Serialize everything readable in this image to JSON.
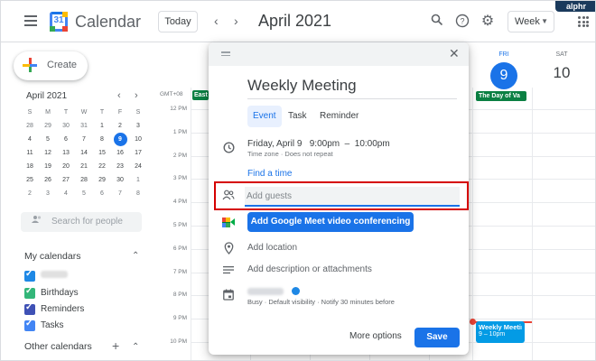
{
  "app": {
    "title": "Calendar",
    "logo_day": "31"
  },
  "watermark": "alphr",
  "toolbar": {
    "today_label": "Today",
    "prev_arrow": "‹",
    "next_arrow": "›",
    "month_title": "April 2021",
    "search_glyph": "⌕",
    "help_glyph": "?",
    "settings_glyph": "⚙",
    "view_select": "Week",
    "view_caret": "▼"
  },
  "sidebar": {
    "create_label": "Create",
    "mini_calendar": {
      "title": "April 2021",
      "prev": "‹",
      "next": "›",
      "weekday_headers": [
        "S",
        "M",
        "T",
        "W",
        "T",
        "F",
        "S"
      ],
      "weeks": [
        [
          "28",
          "29",
          "30",
          "31",
          "1",
          "2",
          "3"
        ],
        [
          "4",
          "5",
          "6",
          "7",
          "8",
          "9",
          "10"
        ],
        [
          "11",
          "12",
          "13",
          "14",
          "15",
          "16",
          "17"
        ],
        [
          "18",
          "19",
          "20",
          "21",
          "22",
          "23",
          "24"
        ],
        [
          "25",
          "26",
          "27",
          "28",
          "29",
          "30",
          "1"
        ],
        [
          "2",
          "3",
          "4",
          "5",
          "6",
          "7",
          "8"
        ]
      ],
      "selected_day": "9"
    },
    "search_people_placeholder": "Search for people",
    "my_calendars_title": "My calendars",
    "my_calendars_caret": "⌃",
    "my_calendars": [
      {
        "label": "",
        "color": "#1e88e5",
        "redacted": true
      },
      {
        "label": "Birthdays",
        "color": "#33b679"
      },
      {
        "label": "Reminders",
        "color": "#3f51b5"
      },
      {
        "label": "Tasks",
        "color": "#4285f4"
      }
    ],
    "other_calendars_title": "Other calendars",
    "other_calendars_add": "+",
    "other_calendars_caret": "⌃"
  },
  "week_grid": {
    "timezone": "GMT+08",
    "hours": [
      "12 PM",
      "1 PM",
      "2 PM",
      "3 PM",
      "4 PM",
      "5 PM",
      "6 PM",
      "7 PM",
      "8 PM",
      "9 PM",
      "10 PM"
    ],
    "allday_left_event": "East",
    "friday": {
      "name": "FRI",
      "num": "9"
    },
    "saturday": {
      "name": "SAT",
      "num": "10"
    },
    "allday_friday_event": "The Day of Va",
    "event": {
      "title": "Weekly Meetin",
      "time": "9 – 10pm",
      "color": "#039be5"
    }
  },
  "dialog": {
    "title": "Weekly Meeting",
    "tabs": [
      "Event",
      "Task",
      "Reminder"
    ],
    "active_tab": "Event",
    "datetime": "Friday, April 9   9:00pm  –  10:00pm",
    "datetime_sub": "Time zone · Does not repeat",
    "find_time": "Find a time",
    "guests_placeholder": "Add guests",
    "meet_button": "Add Google Meet video conferencing",
    "location": "Add location",
    "description": "Add description or attachments",
    "owner_sub": "Busy · Default visibility · Notify 30 minutes before",
    "more_options": "More options",
    "save_label": "Save",
    "close_glyph": "✕",
    "highlight_color": "#d50000"
  }
}
